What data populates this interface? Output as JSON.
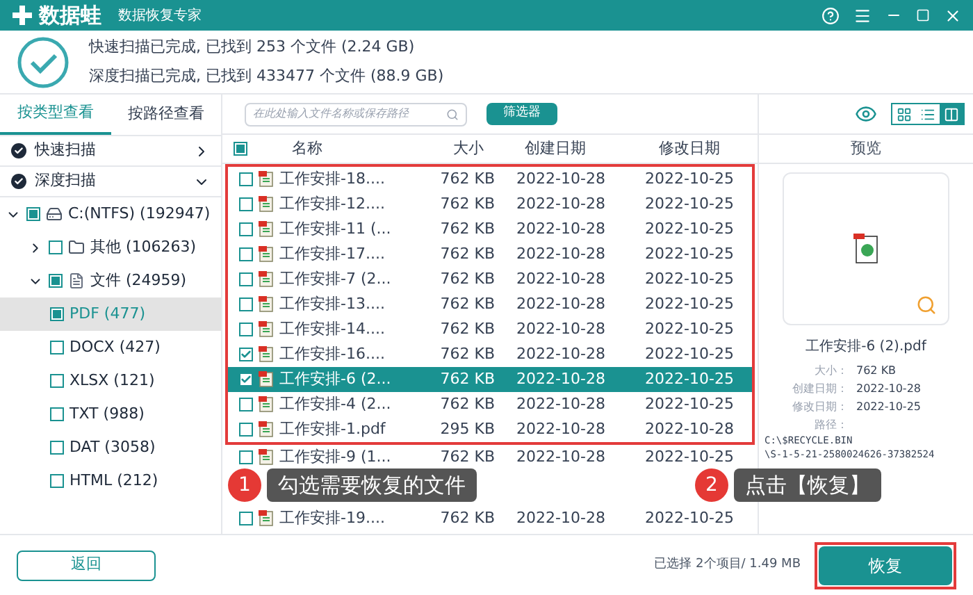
{
  "header": {
    "app_name": "数据蛙",
    "subtitle": "数据恢复专家"
  },
  "scan_summary": [
    "快速扫描已完成, 已找到 253 个文件 (2.24 GB)",
    "深度扫描已完成, 已找到 433477 个文件 (88.9 GB)"
  ],
  "view_tabs": [
    {
      "label": "按类型查看",
      "selected": true
    },
    {
      "label": "按路径查看",
      "selected": false
    }
  ],
  "scans": [
    {
      "label": "快速扫描",
      "expanded": false
    },
    {
      "label": "深度扫描",
      "expanded": true
    }
  ],
  "tree": [
    {
      "label": "C:(NTFS) (192947)",
      "kind": "drive",
      "expanded": true,
      "checked": true,
      "selected": false,
      "children": [
        {
          "label": "其他 (106263)",
          "kind": "folder",
          "expanded": false,
          "checked": false,
          "selected": false
        },
        {
          "label": "文件 (24959)",
          "kind": "document",
          "expanded": true,
          "checked": true,
          "selected": false,
          "children": [
            {
              "label": "PDF (477)",
              "checked": true,
              "selected": true
            },
            {
              "label": "DOCX (427)",
              "checked": false,
              "selected": false
            },
            {
              "label": "XLSX (121)",
              "checked": false,
              "selected": false
            },
            {
              "label": "TXT (988)",
              "checked": false,
              "selected": false
            },
            {
              "label": "DAT (3058)",
              "checked": false,
              "selected": false
            },
            {
              "label": "HTML (212)",
              "checked": false,
              "selected": false
            }
          ]
        }
      ]
    }
  ],
  "search": {
    "placeholder": "在此处输入文件名称或保存路径"
  },
  "filter_button": "筛选器",
  "view_modes": [
    {
      "kind": "grid",
      "selected": false
    },
    {
      "kind": "list",
      "selected": false
    },
    {
      "kind": "preview",
      "selected": true
    }
  ],
  "table": {
    "header_checked": true,
    "columns": [
      "名称",
      "大小",
      "创建日期",
      "修改日期"
    ],
    "highlighted_rows": [
      {
        "name": "工作安排-18....",
        "size": "762 KB",
        "created": "2022-10-28",
        "modified": "2022-10-25",
        "checked": false,
        "selected": false
      },
      {
        "name": "工作安排-12....",
        "size": "762 KB",
        "created": "2022-10-28",
        "modified": "2022-10-25",
        "checked": false,
        "selected": false
      },
      {
        "name": "工作安排-11 (...",
        "size": "762 KB",
        "created": "2022-10-28",
        "modified": "2022-10-25",
        "checked": false,
        "selected": false
      },
      {
        "name": "工作安排-17....",
        "size": "762 KB",
        "created": "2022-10-28",
        "modified": "2022-10-25",
        "checked": false,
        "selected": false
      },
      {
        "name": "工作安排-7 (2...",
        "size": "762 KB",
        "created": "2022-10-28",
        "modified": "2022-10-25",
        "checked": false,
        "selected": false
      },
      {
        "name": "工作安排-13....",
        "size": "762 KB",
        "created": "2022-10-28",
        "modified": "2022-10-25",
        "checked": false,
        "selected": false
      },
      {
        "name": "工作安排-14....",
        "size": "762 KB",
        "created": "2022-10-28",
        "modified": "2022-10-25",
        "checked": false,
        "selected": false
      },
      {
        "name": "工作安排-16....",
        "size": "762 KB",
        "created": "2022-10-28",
        "modified": "2022-10-25",
        "checked": true,
        "selected": false
      },
      {
        "name": "工作安排-6 (2...",
        "size": "762 KB",
        "created": "2022-10-28",
        "modified": "2022-10-25",
        "checked": true,
        "selected": true
      },
      {
        "name": "工作安排-4 (2...",
        "size": "762 KB",
        "created": "2022-10-28",
        "modified": "2022-10-25",
        "checked": false,
        "selected": false
      },
      {
        "name": "工作安排-1.pdf",
        "size": "295 KB",
        "created": "2022-10-28",
        "modified": "2022-10-28",
        "checked": false,
        "selected": false
      }
    ],
    "rows": [
      {
        "name": "工作安排-9 (1...",
        "size": "762 KB",
        "created": "2022-10-28",
        "modified": "2022-10-25",
        "checked": false,
        "selected": false
      },
      {
        "name": "工作安排-19....",
        "size": "762 KB",
        "created": "2022-10-28",
        "modified": "2022-10-25",
        "checked": false,
        "selected": false
      }
    ]
  },
  "preview": {
    "title": "预览",
    "file_name": "工作安排-6 (2).pdf",
    "details": [
      {
        "label": "大小：",
        "value": "762 KB"
      },
      {
        "label": "创建日期：",
        "value": "2022-10-28"
      },
      {
        "label": "修改日期：",
        "value": "2022-10-25"
      }
    ],
    "path_label": "路径：",
    "path_lines": [
      "C:\\$RECYCLE.BIN",
      "\\S-1-5-21-2580024626-37382524"
    ]
  },
  "footer": {
    "back_button": "返回",
    "selection": "已选择 2个项目/ 1.49 MB",
    "recover_button": {
      "label": "恢复",
      "highlighted": true
    }
  },
  "callouts": [
    {
      "number": "1",
      "text": "勾选需要恢复的文件"
    },
    {
      "number": "2",
      "text": "点击【恢复】"
    }
  ]
}
